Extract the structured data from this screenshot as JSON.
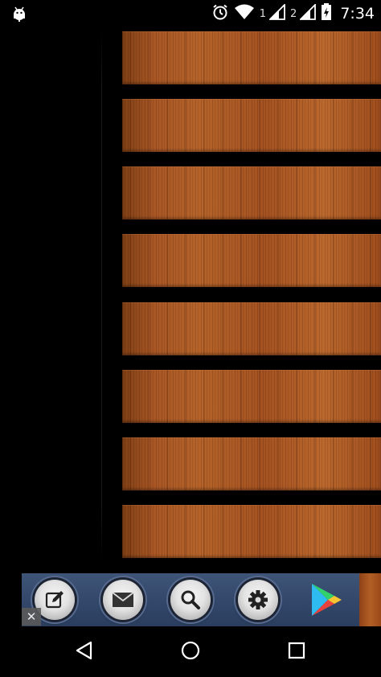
{
  "status_bar": {
    "left_icon": "android-debug-icon",
    "icons": [
      "alarm-icon",
      "wifi-icon",
      "signal-icon-sim1",
      "signal-icon-sim2",
      "battery-charging-icon"
    ],
    "sim1_label": "1",
    "sim2_label": "2",
    "time": "7:34"
  },
  "planks": {
    "count": 8,
    "style": "wood"
  },
  "ad_bar": {
    "buttons": [
      {
        "name": "compose-icon"
      },
      {
        "name": "mail-icon"
      },
      {
        "name": "search-icon"
      },
      {
        "name": "gear-icon"
      }
    ],
    "store_icon": "play-store-icon",
    "close_label": "✕",
    "background_color": "#33486b"
  },
  "nav_bar": {
    "buttons": [
      "back-icon",
      "home-icon",
      "recents-icon"
    ]
  },
  "colors": {
    "wood_primary": "#b25f25",
    "wood_dark": "#7a3a10",
    "background": "#000000"
  }
}
